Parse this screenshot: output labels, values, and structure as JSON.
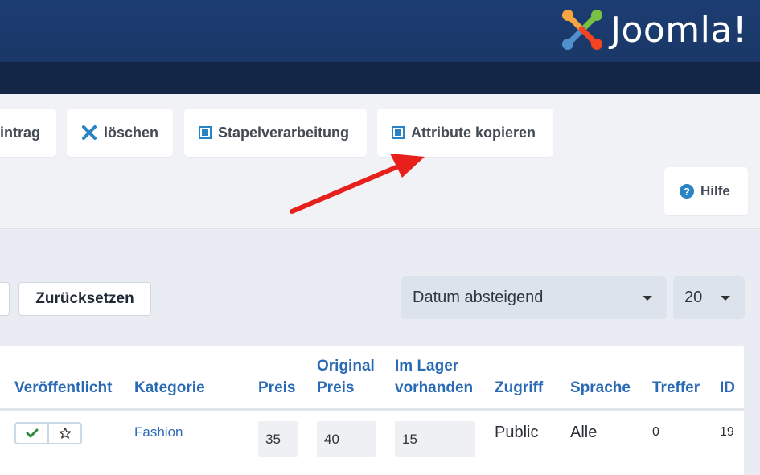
{
  "header": {
    "logo_text": "Joomla!"
  },
  "toolbar": {
    "new_partial_label": "intrag",
    "delete_label": "löschen",
    "batch_label": "Stapelverarbeitung",
    "copy_attributes_label": "Attribute kopieren",
    "help_label": "Hilfe"
  },
  "filters": {
    "reset_label": "Zurücksetzen",
    "sort_selected": "Datum absteigend",
    "limit_selected": "20"
  },
  "table": {
    "headers": {
      "published": "Veröffentlicht",
      "category": "Kategorie",
      "price": "Preis",
      "original_price_1": "Original",
      "original_price_2": "Preis",
      "stock_1": "Im Lager",
      "stock_2": "vorhanden",
      "access": "Zugriff",
      "language": "Sprache",
      "hits": "Treffer",
      "id": "ID"
    },
    "rows": [
      {
        "category": "Fashion",
        "price": "35",
        "original_price": "40",
        "stock": "15",
        "access": "Public",
        "language": "Alle",
        "hits": "0",
        "id": "19"
      }
    ]
  },
  "colors": {
    "header_bg": "#1c3d73",
    "accent": "#2a83c4",
    "link": "#2a6ab5",
    "annotation_arrow": "#e8201c"
  },
  "icons": [
    "joomla-logo",
    "delete-x-icon",
    "batch-square-icon",
    "copy-square-icon",
    "help-icon",
    "check-icon",
    "star-icon",
    "caret-down-icon"
  ]
}
